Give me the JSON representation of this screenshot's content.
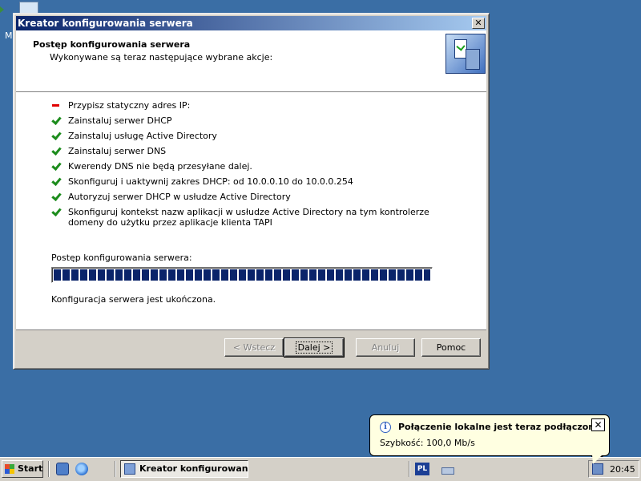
{
  "desktop": {
    "icon_label": "M"
  },
  "window": {
    "title": "Kreator konfigurowania serwera",
    "close_glyph": "✕",
    "header_title": "Postęp konfigurowania serwera",
    "header_subtitle": "Wykonywane są teraz następujące wybrane akcje:",
    "actions": [
      {
        "text": "Przypisz statyczny adres IP:",
        "status": "pending"
      },
      {
        "text": "Zainstaluj serwer DHCP",
        "status": "done"
      },
      {
        "text": "Zainstaluj usługę Active Directory",
        "status": "done"
      },
      {
        "text": "Zainstaluj serwer DNS",
        "status": "done"
      },
      {
        "text": "Kwerendy DNS nie będą przesyłane dalej.",
        "status": "done"
      },
      {
        "text": "Skonfiguruj i uaktywnij zakres DHCP: od 10.0.0.10 do 10.0.0.254",
        "status": "done"
      },
      {
        "text": "Autoryzuj serwer DHCP w usłudze Active Directory",
        "status": "done"
      },
      {
        "text": "Skonfiguruj kontekst nazw aplikacji w usłudze Active Directory na tym kontrolerze domeny do użytku przez aplikacje klienta TAPI",
        "status": "done"
      }
    ],
    "progress_label": "Postęp konfigurowania serwera:",
    "progress_value": 1.0,
    "status_text": "Konfiguracja serwera jest ukończona.",
    "buttons": {
      "back": "< Wstecz",
      "next": "Dalej >",
      "cancel": "Anuluj",
      "help": "Pomoc"
    }
  },
  "balloon": {
    "info_glyph": "i",
    "title": "Połączenie lokalne jest teraz podłączone.",
    "text": "Szybkość: 100,0 Mb/s",
    "close_glyph": "✕"
  },
  "taskbar": {
    "start_label": "Start",
    "task_label": "Kreator konfigurowan...",
    "language": "PL",
    "clock": "20:45"
  },
  "colors": {
    "desktop": "#3a6ea5",
    "titlebar_start": "#0a246a",
    "titlebar_end": "#a6caf0",
    "progress": "#0a246a",
    "done_check": "#1c8c1c",
    "pending_dash": "#e00000",
    "balloon_bg": "#ffffe1"
  }
}
